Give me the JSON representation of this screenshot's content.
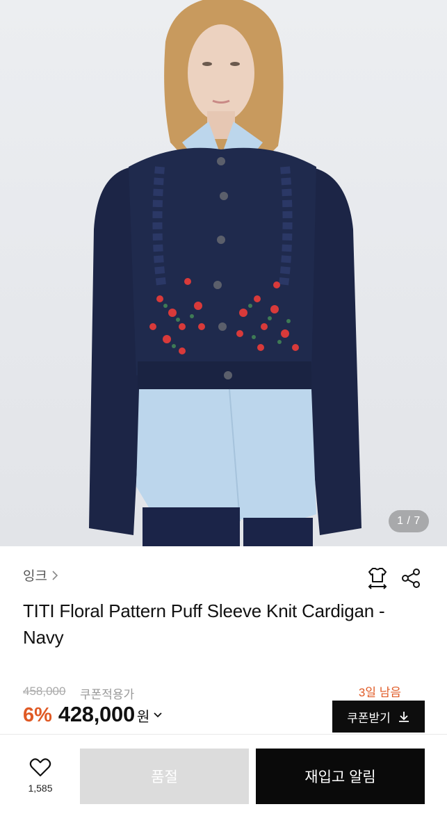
{
  "gallery": {
    "counter": "1 / 7",
    "image_alt": "Model wearing navy cable-knit cardigan with red floral embroidery over a light blue shirt"
  },
  "brand": {
    "name": "잉크",
    "chevron_icon": "chevron-right-icon"
  },
  "actions": {
    "size_icon": "size-guide-icon",
    "share_icon": "share-icon"
  },
  "product": {
    "title": "TITI Floral Pattern Puff Sleeve Knit Cardigan - Navy"
  },
  "pricing": {
    "original_price": "458,000",
    "coupon_label": "쿠폰적용가",
    "days_left": "3일 남음",
    "discount": "6%",
    "price": "428,000",
    "currency": "원",
    "coupon_button_label": "쿠폰받기",
    "accent_color": "#e05a25"
  },
  "bottom_bar": {
    "like_count": "1,585",
    "soldout_label": "품절",
    "restock_label": "재입고 알림"
  }
}
